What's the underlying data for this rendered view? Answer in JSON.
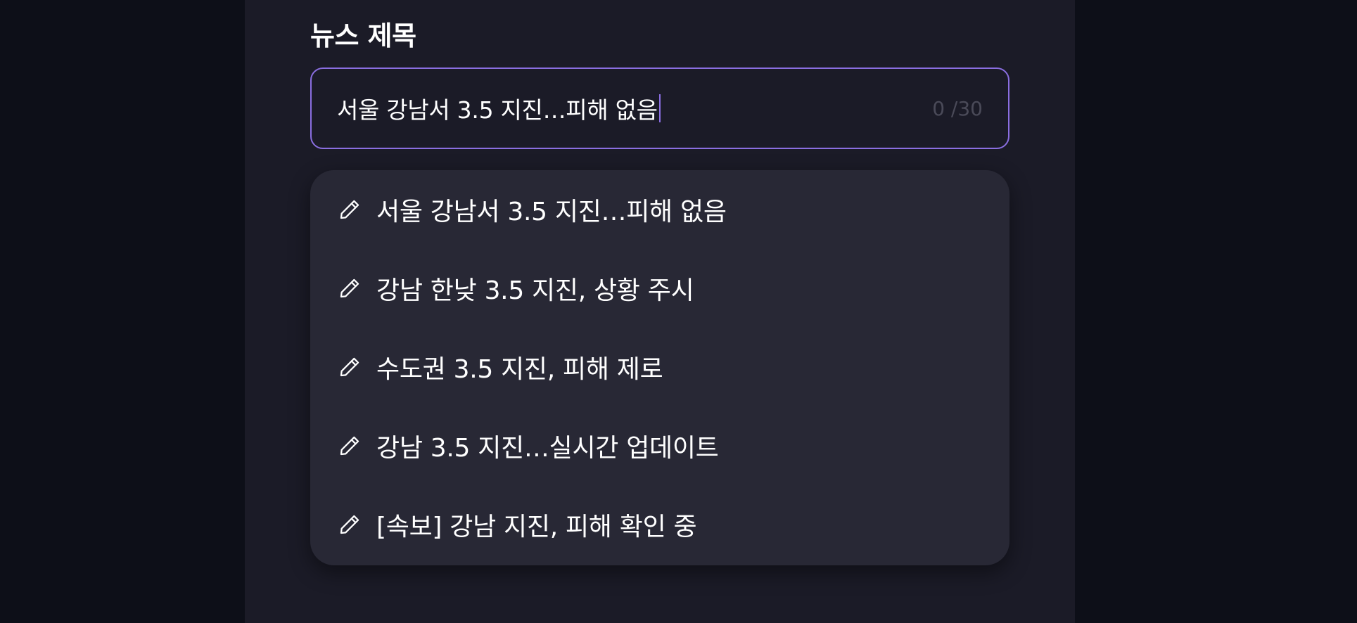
{
  "colors": {
    "background": "#0d0f18",
    "panel": "#1b1b27",
    "dropdown": "#282835",
    "accent": "#8a6ee0",
    "muted_text": "#4a4a58"
  },
  "field": {
    "label": "뉴스 제목",
    "value": "서울 강남서 3.5 지진…피해 없음",
    "char_count": "0 /30"
  },
  "suggestions": {
    "icon": "pencil-icon",
    "items": [
      {
        "label": "서울 강남서 3.5 지진…피해 없음"
      },
      {
        "label": "강남 한낮 3.5 지진, 상황 주시"
      },
      {
        "label": "수도권 3.5 지진, 피해 제로"
      },
      {
        "label": "강남 3.5 지진…실시간 업데이트"
      },
      {
        "label": "[속보] 강남 지진, 피해 확인 중"
      }
    ]
  }
}
